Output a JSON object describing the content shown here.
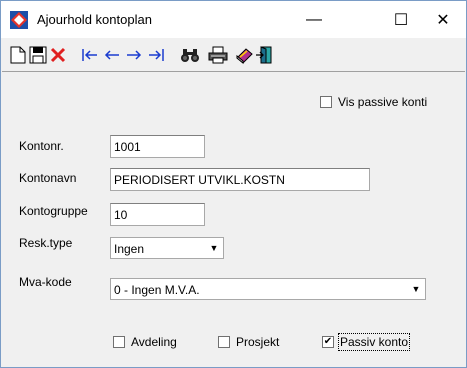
{
  "window": {
    "title": "Ajourhold kontoplan",
    "minimize_glyph": "—",
    "maximize_glyph": "☐",
    "close_glyph": "✕"
  },
  "toolbar": {
    "icons": [
      "new-document-icon",
      "save-icon",
      "delete-icon",
      "first-record-icon",
      "previous-record-icon",
      "next-record-icon",
      "last-record-icon",
      "search-icon",
      "print-icon",
      "book-icon",
      "exit-icon"
    ]
  },
  "filters": {
    "show_inactive_label": "Vis passive konti",
    "show_inactive_checked": false
  },
  "form": {
    "account_no_label": "Kontonr.",
    "account_no_value": "1001",
    "account_name_label": "Kontonavn",
    "account_name_value": "PERIODISERT UTVIKL.KOSTN",
    "account_group_label": "Kontogruppe",
    "account_group_value": "10",
    "ledger_type_label": "Resk.type",
    "ledger_type_value": "Ingen",
    "vat_code_label": "Mva-kode",
    "vat_code_value": "0 - Ingen M.V.A."
  },
  "options": {
    "department_label": "Avdeling",
    "department_checked": false,
    "project_label": "Prosjekt",
    "project_checked": false,
    "inactive_account_label": "Passiv konto",
    "inactive_account_checked": true
  },
  "colors": {
    "window_border": "#7a9cc6",
    "dialog_bg": "#f0f0f0",
    "delete_red": "#e02020"
  }
}
